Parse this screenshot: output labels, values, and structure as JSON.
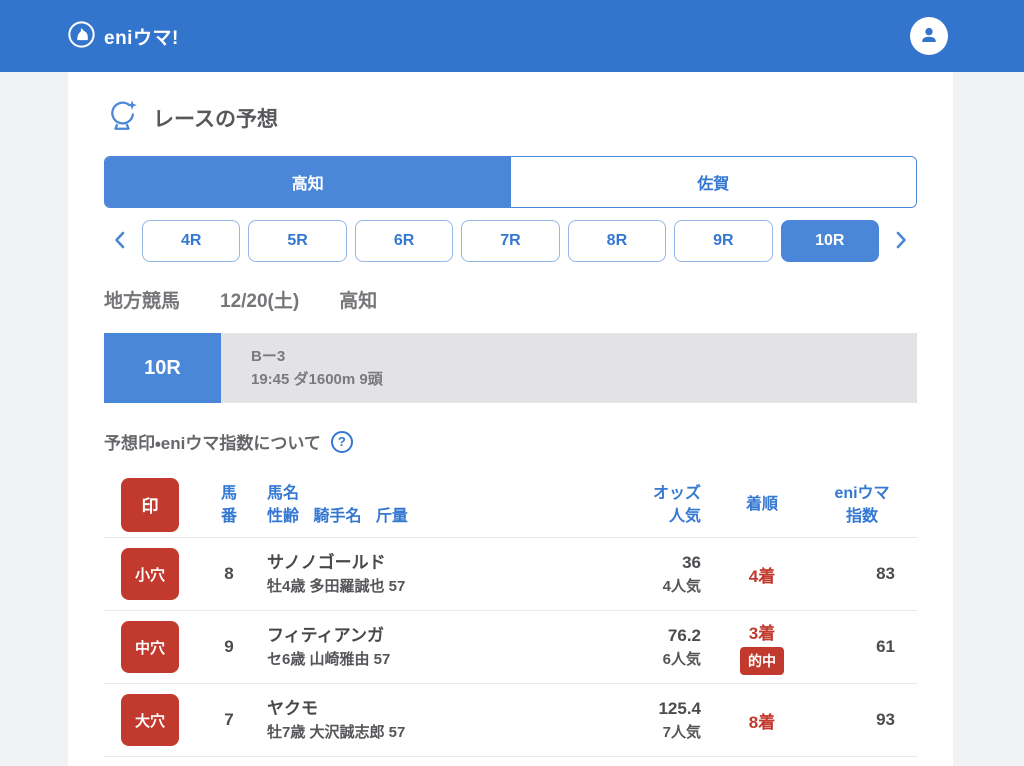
{
  "colors": {
    "brand_blue": "#3374cd",
    "accent_blue": "#4a87d8",
    "link_blue": "#3478d2",
    "status_red": "#c23a2d",
    "race_bar_gray": "#e3e3e5"
  },
  "header": {
    "logo_text": "eniウマ!"
  },
  "page": {
    "title": "レースの予想"
  },
  "venue_tabs": [
    {
      "label": "高知",
      "selected": true
    },
    {
      "label": "佐賀",
      "selected": false
    }
  ],
  "race_nav": {
    "items": [
      {
        "label": "4R",
        "selected": false
      },
      {
        "label": "5R",
        "selected": false
      },
      {
        "label": "6R",
        "selected": false
      },
      {
        "label": "7R",
        "selected": false
      },
      {
        "label": "8R",
        "selected": false
      },
      {
        "label": "9R",
        "selected": false
      },
      {
        "label": "10R",
        "selected": true
      }
    ]
  },
  "race_meta": {
    "category": "地方競馬",
    "date": "12/20(土)",
    "venue": "高知"
  },
  "race_info": {
    "race_no": "10R",
    "race_class": "Bー3",
    "detail": "19:45 ダ1600m 9頭"
  },
  "about": {
    "label": "予想印・eniウマ指数について",
    "help_glyph": "?"
  },
  "table": {
    "header": {
      "mark": "印",
      "number_line1": "馬",
      "number_line2": "番",
      "name_line1": "馬名",
      "name_line2": "性齢 騎手名 斤量",
      "odds_line1": "オッズ",
      "odds_line2": "人気",
      "rank": "着順",
      "index_line1": "eniウマ",
      "index_line2": "指数"
    },
    "rows": [
      {
        "mark": "小穴",
        "number": "8",
        "name": "サノノゴールド",
        "details": "牡4歳 多田羅誠也 57",
        "odds": "36",
        "popularity": "4人気",
        "rank": "4着",
        "hit": "",
        "index": "83"
      },
      {
        "mark": "中穴",
        "number": "9",
        "name": "フィティアンガ",
        "details": "セ6歳 山崎雅由 57",
        "odds": "76.2",
        "popularity": "6人気",
        "rank": "3着",
        "hit": "的中",
        "index": "61"
      },
      {
        "mark": "大穴",
        "number": "7",
        "name": "ヤクモ",
        "details": "牡7歳 大沢誠志郎 57",
        "odds": "125.4",
        "popularity": "7人気",
        "rank": "8着",
        "hit": "",
        "index": "93"
      }
    ]
  }
}
